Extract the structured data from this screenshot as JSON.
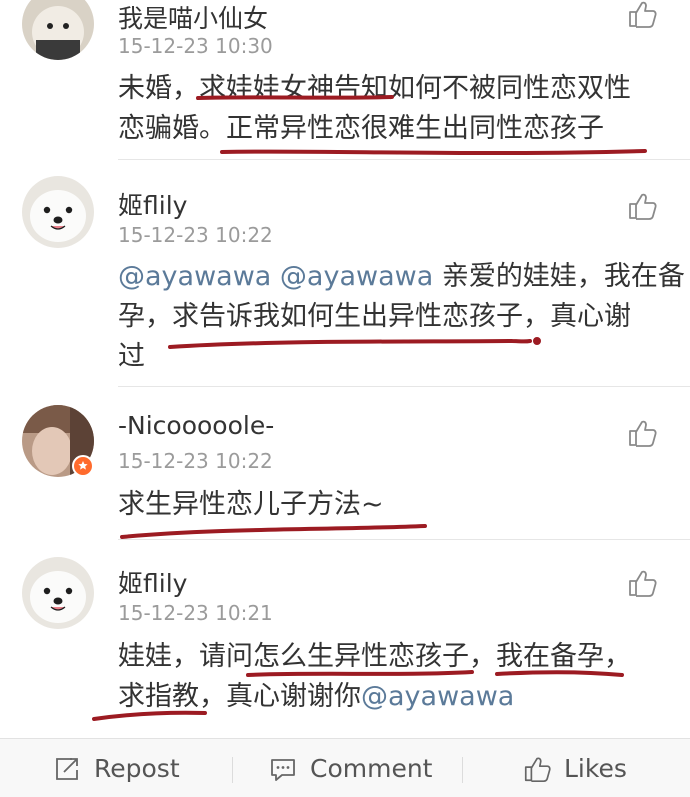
{
  "comments": [
    {
      "username": "我是喵小仙女",
      "timestamp": "15-12-23 10:30",
      "lines": [
        "未婚，求娃娃女神告知如何不被同性恋双性",
        "恋骗婚。正常异性恋很难生出同性恋孩子"
      ]
    },
    {
      "username": "姬flily",
      "timestamp": "15-12-23 10:22",
      "mentions": [
        "@ayawawa",
        "@ayawawa"
      ],
      "lines": [
        "亲爱的娃娃，我在备",
        "孕，求告诉我如何生出异性恋孩子，真心谢",
        "过"
      ]
    },
    {
      "username": "-Nicooooole-",
      "timestamp": "15-12-23 10:22",
      "lines": [
        "求生异性恋儿子方法~"
      ]
    },
    {
      "username": "姬flily",
      "timestamp": "15-12-23 10:21",
      "mention": "@ayawawa",
      "lines": [
        "娃娃，请问怎么生异性恋孩子，我在备孕，",
        "求指教，真心谢谢你"
      ]
    }
  ],
  "bottom_bar": {
    "repost_label": "Repost",
    "comment_label": "Comment",
    "likes_label": "Likes"
  },
  "icons": {
    "like": "thumbs-up-icon",
    "repost": "repost-icon",
    "comment": "comment-icon",
    "badge": "verified-badge-icon"
  },
  "colors": {
    "text": "#333333",
    "timestamp": "#9b9b9b",
    "mention": "#5b7a99",
    "ink_underline": "#9c1b22",
    "divider": "#e6e6e6"
  }
}
